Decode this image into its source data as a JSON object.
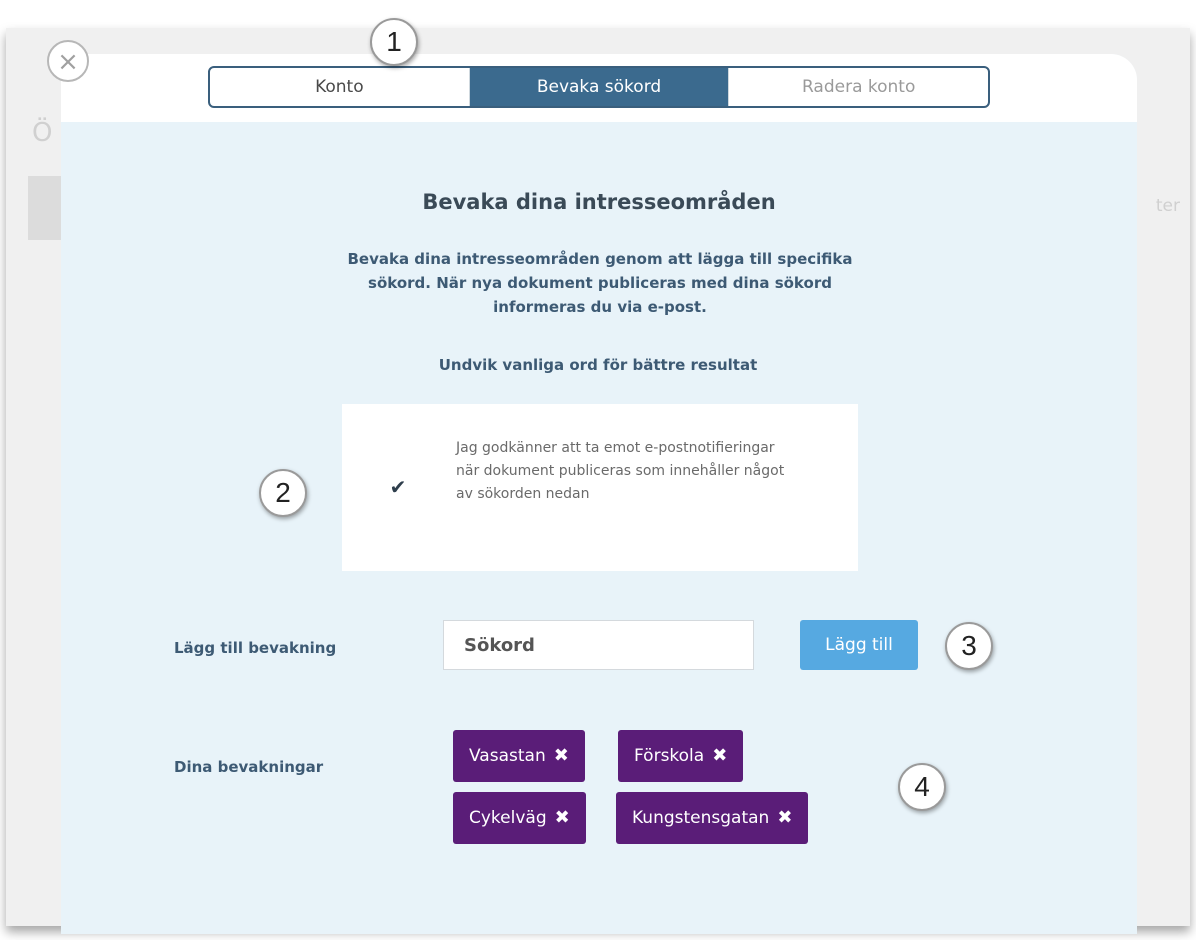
{
  "background": {
    "heading_fragment": "Ö",
    "right_fragment": "ter"
  },
  "modal": {
    "close_glyph": "×",
    "tabs": [
      {
        "label": "Konto",
        "state": "inactive"
      },
      {
        "label": "Bevaka sökord",
        "state": "active"
      },
      {
        "label": "Radera konto",
        "state": "muted"
      }
    ],
    "title": "Bevaka dina intresseområden",
    "intro": "Bevaka dina intresseområden genom att lägga till specifika sökord. När nya dokument publiceras med dina sökord informeras du via e-post.",
    "tip": "Undvik vanliga ord för bättre resultat",
    "consent": {
      "checked": true,
      "check_glyph": "✔",
      "text": "Jag godkänner att ta emot e-postnotifieringar när dokument publiceras som innehåller något av sökorden nedan"
    },
    "add_watch": {
      "label": "Lägg till bevakning",
      "input_placeholder": "Sökord",
      "input_value": "",
      "button_label": "Lägg till"
    },
    "watches": {
      "label": "Dina bevakningar",
      "remove_glyph": "✖",
      "items": [
        "Vasastan",
        "Förskola",
        "Cykelväg",
        "Kungstensgatan"
      ]
    }
  },
  "callouts": [
    "1",
    "2",
    "3",
    "4"
  ],
  "colors": {
    "tab_active": "#3b6a8e",
    "chip": "#5a1d78",
    "button": "#56a9e1",
    "panel": "#e8f3f9"
  }
}
